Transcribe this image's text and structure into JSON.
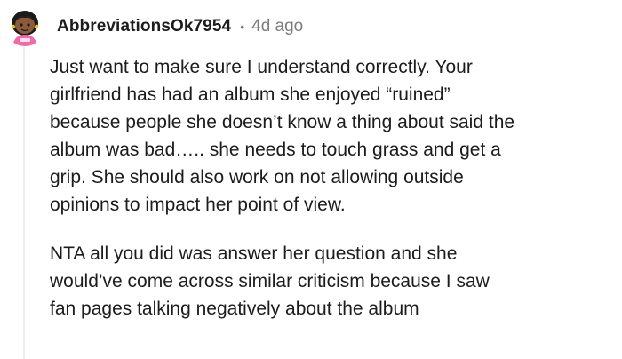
{
  "comment": {
    "author": "AbbreviationsOk7954",
    "separator": "•",
    "time_ago": "4d ago",
    "avatar_icon": "snoo-avatar-icon",
    "paragraphs": [
      "Just want to make sure I understand correctly. Your\ngirlfriend has had an album she enjoyed “ruined”\nbecause people she doesn’t know a thing about said the\nalbum was bad….. she needs to touch grass and get a\ngrip. She should also work on not allowing outside\nopinions to impact her point of view.",
      "NTA all you did was answer her question and she\nwould’ve come across similar criticism because I saw\nfan pages talking negatively about the album"
    ]
  },
  "colors": {
    "text": "#1c1c1c",
    "meta": "#7c7c7c",
    "thread_line": "#eceeef",
    "avatar_skin": "#8b5a3c",
    "avatar_hair": "#1b1b1b",
    "avatar_shirt": "#f06aa7"
  }
}
